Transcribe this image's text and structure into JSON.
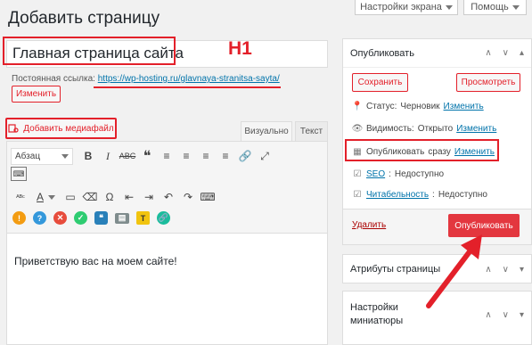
{
  "header": {
    "page_title": "Добавить страницу",
    "screen_options_label": "Настройки экрана",
    "help_label": "Помощь"
  },
  "editor": {
    "title_value": "Главная страница сайта",
    "h1_annotation": "H1",
    "permalink_label": "Постоянная ссылка:",
    "permalink_url": "https://wp-hosting.ru/glavnaya-stranitsa-sayta/",
    "edit_permalink_label": "Изменить",
    "add_media_label": "Добавить медиафайл",
    "tabs": [
      {
        "label": "Визуально",
        "active": true
      },
      {
        "label": "Текст",
        "active": false
      }
    ],
    "format_select": "Абзац",
    "content_text": "Приветствую вас на моем сайте!"
  },
  "toolbar_icons": {
    "row1": [
      "bold-icon",
      "italic-icon",
      "strikethrough-icon",
      "blockquote-icon",
      "align-left-icon",
      "align-center-icon",
      "align-right-icon",
      "align-justify-icon",
      "link-icon",
      "fullscreen-icon"
    ],
    "row1_glyphs": [
      "B",
      "I",
      "ABC",
      "❝",
      "≡",
      "≡",
      "≡",
      "≡",
      "🔗",
      "⤢"
    ],
    "row2_glyphs": [
      "ᴬᴮᶜ",
      "A",
      "Ω",
      "⇥",
      "⇤",
      "↶",
      "↷",
      "⌨"
    ],
    "row3_glyphs": [
      "!",
      "?",
      "✕",
      "✓",
      "❝",
      "▤",
      "T",
      "🔗"
    ]
  },
  "sidebar": {
    "publish_box": {
      "title": "Опубликовать",
      "save_label": "Сохранить",
      "preview_label": "Просмотреть",
      "status_label": "Статус:",
      "status_value": "Черновик",
      "visibility_label": "Видимость:",
      "visibility_value": "Открыто",
      "publish_when_label": "Опубликовать",
      "publish_when_value": "сразу",
      "seo_label": "SEO",
      "seo_value": "Недоступно",
      "readability_label": "Читабельность",
      "readability_value": "Недоступно",
      "change_label": "Изменить",
      "delete_label": "Удалить",
      "publish_button": "Опубликовать"
    },
    "attributes_box": {
      "title": "Атрибуты страницы"
    },
    "thumbnail_box": {
      "title": "Настройки миниатюры"
    }
  },
  "colors": {
    "accent_red": "#e3202a",
    "publish_button": "#e3373f",
    "link_blue": "#0073aa"
  }
}
